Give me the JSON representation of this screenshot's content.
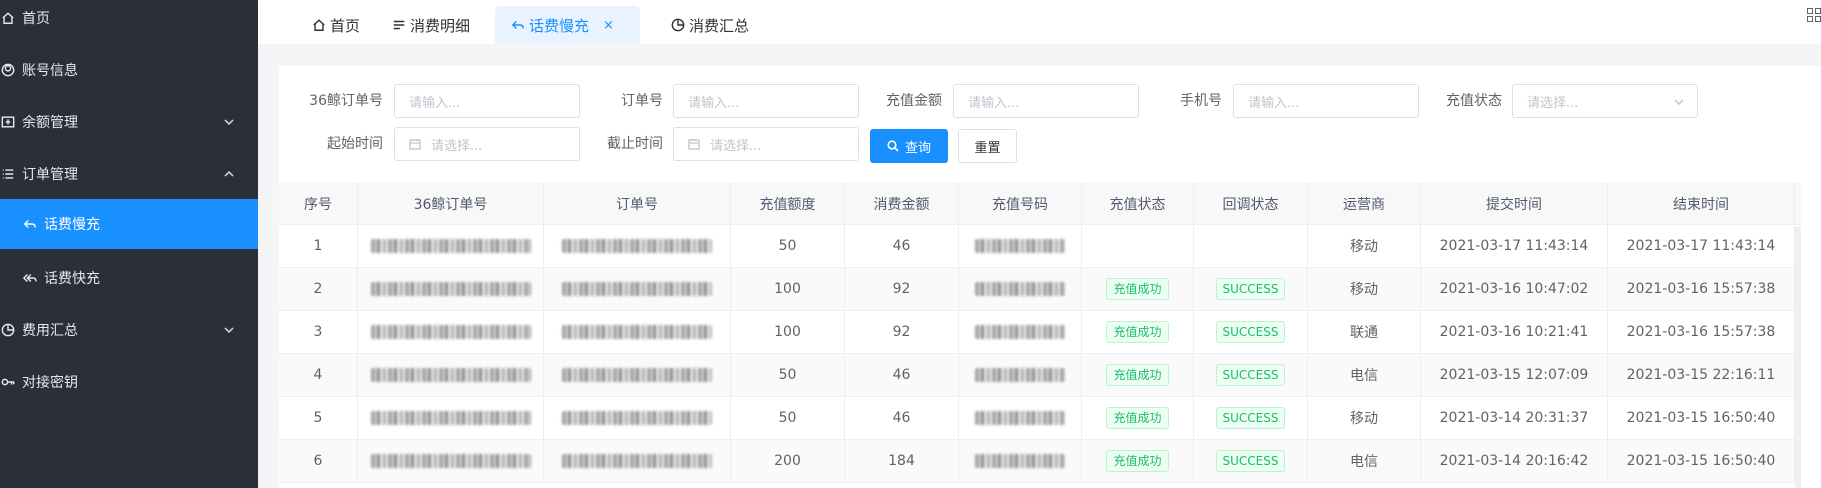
{
  "sidebar": {
    "items": [
      {
        "label": "首页",
        "icon": "home-icon"
      },
      {
        "label": "账号信息",
        "icon": "user-icon"
      },
      {
        "label": "余额管理",
        "icon": "wallet-icon",
        "arrow": "down"
      },
      {
        "label": "订单管理",
        "icon": "list-icon",
        "arrow": "up"
      },
      {
        "label": "话费慢充",
        "icon": "reply-icon",
        "active": true
      },
      {
        "label": "话费快充",
        "icon": "reply-all-icon"
      },
      {
        "label": "费用汇总",
        "icon": "pie-icon",
        "arrow": "down"
      },
      {
        "label": "对接密钥",
        "icon": "key-icon"
      }
    ]
  },
  "tabs": [
    {
      "label": "首页",
      "icon": "home-icon"
    },
    {
      "label": "消费明细",
      "icon": "list-icon"
    },
    {
      "label": "话费慢充",
      "icon": "reply-icon",
      "active": true,
      "close": "×"
    },
    {
      "label": "消费汇总",
      "icon": "pie-icon"
    }
  ],
  "filters": {
    "order36_label": "36鲸订单号",
    "order_label": "订单号",
    "amount_label": "充值金额",
    "phone_label": "手机号",
    "status_label": "充值状态",
    "start_label": "起始时间",
    "end_label": "截止时间",
    "input_placeholder": "请输入...",
    "select_placeholder": "请选择...",
    "search_button": "查询",
    "reset_button": "重置"
  },
  "table": {
    "columns": [
      "序号",
      "36鲸订单号",
      "订单号",
      "充值额度",
      "消费金额",
      "充值号码",
      "充值状态",
      "回调状态",
      "运营商",
      "提交时间",
      "结束时间"
    ],
    "rows": [
      {
        "no": "1",
        "quota": "50",
        "cost": "46",
        "status": "",
        "callback": "",
        "carrier": "移动",
        "submit": "2021-03-17 11:43:14",
        "end": "2021-03-17 11:43:14"
      },
      {
        "no": "2",
        "quota": "100",
        "cost": "92",
        "status": "充值成功",
        "callback": "SUCCESS",
        "carrier": "移动",
        "submit": "2021-03-16 10:47:02",
        "end": "2021-03-16 15:57:38"
      },
      {
        "no": "3",
        "quota": "100",
        "cost": "92",
        "status": "充值成功",
        "callback": "SUCCESS",
        "carrier": "联通",
        "submit": "2021-03-16 10:21:41",
        "end": "2021-03-16 15:57:38"
      },
      {
        "no": "4",
        "quota": "50",
        "cost": "46",
        "status": "充值成功",
        "callback": "SUCCESS",
        "carrier": "电信",
        "submit": "2021-03-15 12:07:09",
        "end": "2021-03-15 22:16:11"
      },
      {
        "no": "5",
        "quota": "50",
        "cost": "46",
        "status": "充值成功",
        "callback": "SUCCESS",
        "carrier": "移动",
        "submit": "2021-03-14 20:31:37",
        "end": "2021-03-15 16:50:40"
      },
      {
        "no": "6",
        "quota": "200",
        "cost": "184",
        "status": "充值成功",
        "callback": "SUCCESS",
        "carrier": "电信",
        "submit": "2021-03-14 20:16:42",
        "end": "2021-03-15 16:50:40"
      }
    ]
  },
  "colors": {
    "primary": "#1890ff",
    "sidebar": "#2b2f3a",
    "success": "#19be6b"
  }
}
